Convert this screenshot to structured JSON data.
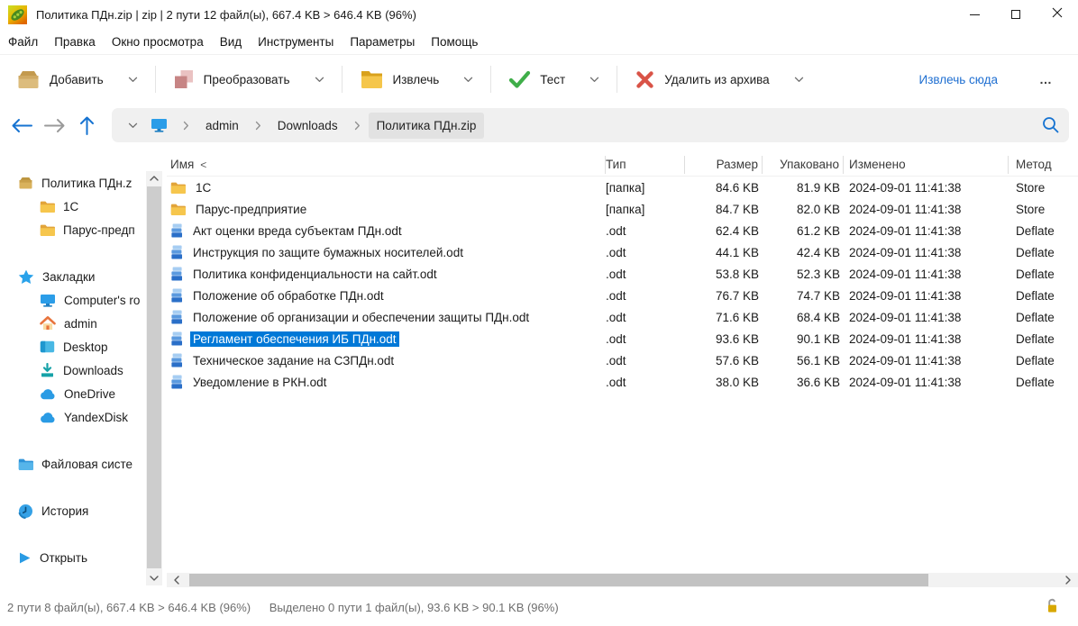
{
  "window": {
    "title": "Политика ПДн.zip | zip | 2 пути 12 файл(ы), 667.4 KB > 646.4 KB (96%)"
  },
  "menu": {
    "items": [
      "Файл",
      "Правка",
      "Окно просмотра",
      "Вид",
      "Инструменты",
      "Параметры",
      "Помощь"
    ]
  },
  "toolbar": {
    "buttons": [
      {
        "key": "add",
        "label": "Добавить",
        "dropdown": true
      },
      {
        "key": "convert",
        "label": "Преобразовать",
        "dropdown": true
      },
      {
        "key": "extract",
        "label": "Извлечь",
        "dropdown": true
      },
      {
        "key": "test",
        "label": "Тест",
        "dropdown": true
      },
      {
        "key": "delete",
        "label": "Удалить из архива",
        "dropdown": true
      }
    ],
    "extract_here_label": "Извлечь сюда",
    "more_label": "…"
  },
  "addressbar": {
    "crumbs": [
      "admin",
      "Downloads",
      "Политика ПДн.zip"
    ],
    "current_index": 2
  },
  "sidebar": {
    "sections": [
      {
        "items": [
          {
            "icon": "archive",
            "label": "Политика ПДн.z",
            "indent": 0
          },
          {
            "icon": "folder",
            "label": "1C",
            "indent": 1
          },
          {
            "icon": "folder",
            "label": "Парус-предп",
            "indent": 1
          }
        ]
      },
      {
        "items": [
          {
            "icon": "star",
            "label": "Закладки",
            "indent": 0
          },
          {
            "icon": "computer",
            "label": "Computer's ro",
            "indent": 1
          },
          {
            "icon": "home",
            "label": "admin",
            "indent": 1
          },
          {
            "icon": "desktop",
            "label": "Desktop",
            "indent": 1
          },
          {
            "icon": "downloads",
            "label": "Downloads",
            "indent": 1
          },
          {
            "icon": "cloud",
            "label": "OneDrive",
            "indent": 1
          },
          {
            "icon": "cloud",
            "label": "YandexDisk",
            "indent": 1
          }
        ]
      },
      {
        "items": [
          {
            "icon": "bluefolder",
            "label": "Файловая систе",
            "indent": 0
          }
        ]
      },
      {
        "items": [
          {
            "icon": "history",
            "label": "История",
            "indent": 0
          }
        ]
      },
      {
        "items": [
          {
            "icon": "play",
            "label": "Открыть",
            "indent": 0
          }
        ]
      }
    ]
  },
  "filelist": {
    "columns": {
      "name": "Имя",
      "name_sort": "<",
      "type": "Тип",
      "size": "Размер",
      "packed": "Упаковано",
      "modified": "Изменено",
      "method": "Метод"
    },
    "selected_index": 7,
    "rows": [
      {
        "icon": "folder",
        "name": "1C",
        "type": "[папка]",
        "size": "84.6 KB",
        "packed": "81.9 KB",
        "modified": "2024-09-01 11:41:38",
        "method": "Store"
      },
      {
        "icon": "folder",
        "name": "Парус-предприятие",
        "type": "[папка]",
        "size": "84.7 KB",
        "packed": "82.0 KB",
        "modified": "2024-09-01 11:41:38",
        "method": "Store"
      },
      {
        "icon": "odt",
        "name": "Акт оценки вреда субъектам ПДн.odt",
        "type": ".odt",
        "size": "62.4 KB",
        "packed": "61.2 KB",
        "modified": "2024-09-01 11:41:38",
        "method": "Deflate"
      },
      {
        "icon": "odt",
        "name": "Инструкция по защите бумажных носителей.odt",
        "type": ".odt",
        "size": "44.1 KB",
        "packed": "42.4 KB",
        "modified": "2024-09-01 11:41:38",
        "method": "Deflate"
      },
      {
        "icon": "odt",
        "name": "Политика конфиденциальности на сайт.odt",
        "type": ".odt",
        "size": "53.8 KB",
        "packed": "52.3 KB",
        "modified": "2024-09-01 11:41:38",
        "method": "Deflate"
      },
      {
        "icon": "odt",
        "name": "Положение об обработке ПДн.odt",
        "type": ".odt",
        "size": "76.7 KB",
        "packed": "74.7 KB",
        "modified": "2024-09-01 11:41:38",
        "method": "Deflate"
      },
      {
        "icon": "odt",
        "name": "Положение об организации и обеспечении защиты ПДн.odt",
        "type": ".odt",
        "size": "71.6 KB",
        "packed": "68.4 KB",
        "modified": "2024-09-01 11:41:38",
        "method": "Deflate"
      },
      {
        "icon": "odt",
        "name": "Регламент обеспечения ИБ ПДн.odt",
        "type": ".odt",
        "size": "93.6 KB",
        "packed": "90.1 KB",
        "modified": "2024-09-01 11:41:38",
        "method": "Deflate"
      },
      {
        "icon": "odt",
        "name": "Техническое задание на СЗПДн.odt",
        "type": ".odt",
        "size": "57.6 KB",
        "packed": "56.1 KB",
        "modified": "2024-09-01 11:41:38",
        "method": "Deflate"
      },
      {
        "icon": "odt",
        "name": "Уведомление в РКН.odt",
        "type": ".odt",
        "size": "38.0 KB",
        "packed": "36.6 KB",
        "modified": "2024-09-01 11:41:38",
        "method": "Deflate"
      }
    ]
  },
  "statusbar": {
    "summary": "2 пути 8 файл(ы), 667.4 KB > 646.4 KB (96%)",
    "selection": "Выделено 0 пути 1 файл(ы), 93.6 KB > 90.1 KB (96%)"
  }
}
